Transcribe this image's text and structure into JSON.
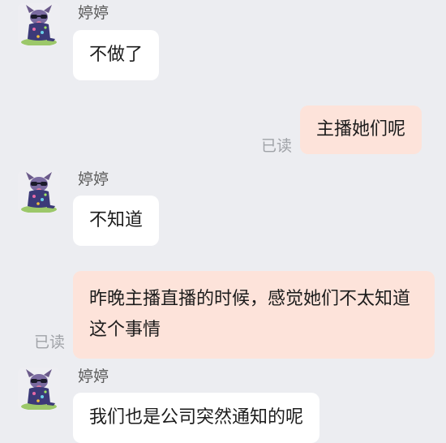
{
  "messages": [
    {
      "sender": "婷婷",
      "text": "不做了"
    },
    {
      "text": "主播她们呢",
      "status": "已读"
    },
    {
      "sender": "婷婷",
      "text": "不知道"
    },
    {
      "text": "昨晚主播直播的时候，感觉她们不太知道这个事情",
      "status": "已读"
    },
    {
      "sender": "婷婷",
      "text": "我们也是公司突然通知的呢"
    }
  ],
  "colors": {
    "background": "#ecedf1",
    "incoming_bubble": "#ffffff",
    "outgoing_bubble": "#fde3da"
  },
  "icons": {
    "avatar": "chihuahua-with-sunglasses-avatar-icon"
  }
}
